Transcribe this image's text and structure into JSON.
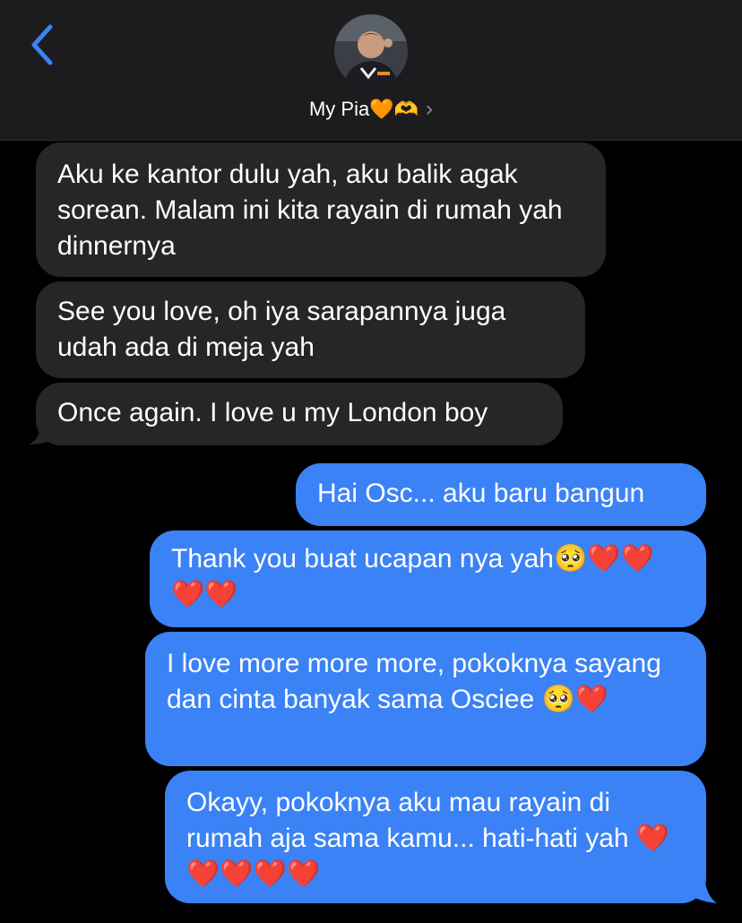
{
  "header": {
    "contact_name": "My Pia",
    "contact_emoji": "🧡🫶",
    "chevron": "›",
    "back_icon": "chevron-left-icon",
    "accent": "#3a82f6"
  },
  "messages": [
    {
      "direction": "received",
      "text": "Aku ke kantor dulu yah, aku balik agak sorean. Malam ini kita rayain di rumah yah dinnernya"
    },
    {
      "direction": "received",
      "text": "See you love, oh iya sarapannya juga udah ada di meja yah"
    },
    {
      "direction": "received",
      "text": "Once again. I love u my London boy"
    },
    {
      "direction": "sent",
      "text": "Hai Osc... aku baru bangun"
    },
    {
      "direction": "sent",
      "text": "Thank you buat ucapan nya yah🥺❤️❤️❤️❤️"
    },
    {
      "direction": "sent",
      "text": "I love more more more, pokoknya sayang dan cinta banyak sama Osciee 🥺❤️"
    },
    {
      "direction": "sent",
      "text": "Okayy, pokoknya aku mau rayain di rumah aja sama kamu... hati-hati yah ❤️❤️❤️❤️❤️"
    }
  ],
  "colors": {
    "received_bubble": "#262628",
    "sent_bubble": "#3a82f6",
    "background": "#000000"
  }
}
